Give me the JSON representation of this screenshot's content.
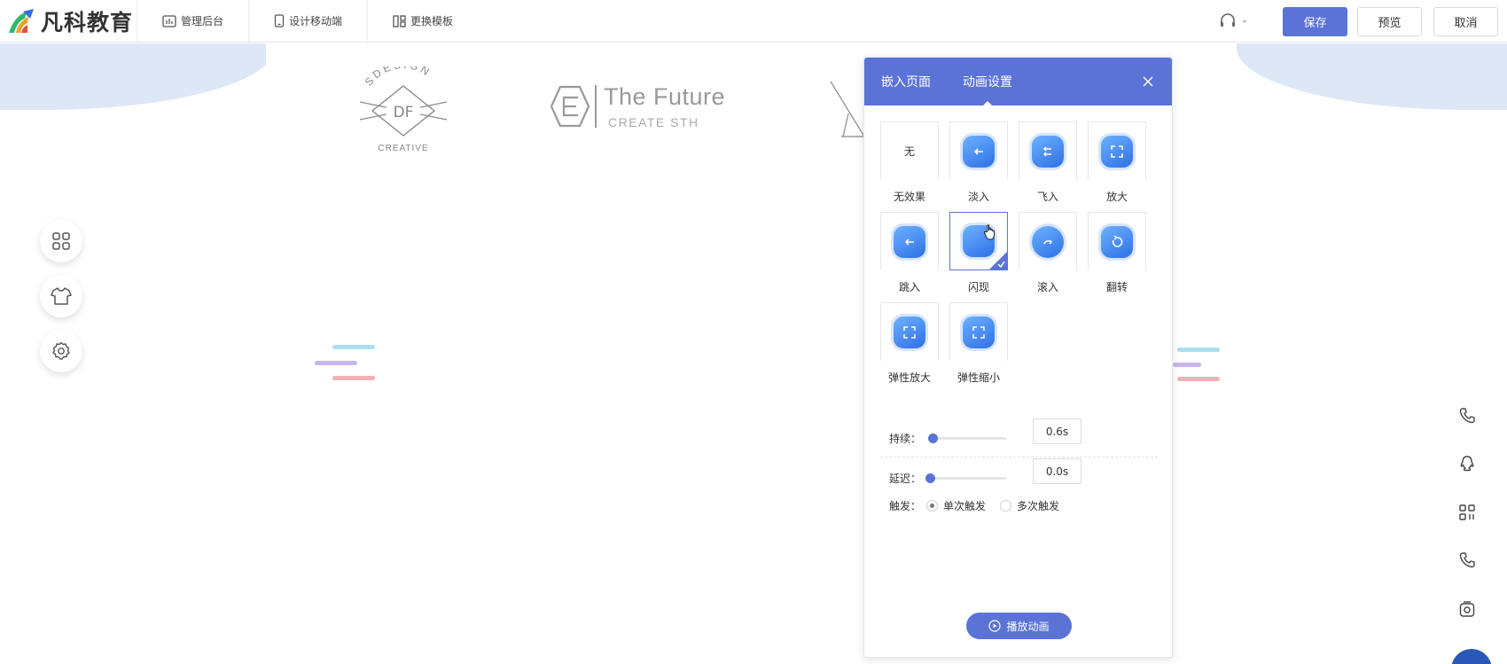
{
  "brand": {
    "name": "凡科教育"
  },
  "nav": [
    {
      "label": "管理后台",
      "icon": "chart-icon"
    },
    {
      "label": "设计移动端",
      "icon": "phone-icon"
    },
    {
      "label": "更换模板",
      "icon": "template-icon"
    }
  ],
  "actions": {
    "save": "保存",
    "preview": "预览",
    "cancel": "取消"
  },
  "colors": {
    "accent": "#5b73d6",
    "band": "#dde7f6"
  },
  "canvas": {
    "logo1": {
      "top": "SDESIGN",
      "mid": "DF",
      "bottom": "CREATIVE"
    },
    "logo2": {
      "title": "The Future",
      "subtitle": "CREATE STH"
    }
  },
  "panel": {
    "tabs": [
      "嵌入页面",
      "动画设置"
    ],
    "active_tab": "动画设置",
    "none_label": "无",
    "effects": [
      "无效果",
      "淡入",
      "飞入",
      "放大",
      "跳入",
      "闪现",
      "滚入",
      "翻转",
      "弹性放大",
      "弹性缩小"
    ],
    "selected_effect": "闪现",
    "duration": {
      "label": "持续：",
      "value": "0.6s"
    },
    "delay": {
      "label": "延迟：",
      "value": "0.0s"
    },
    "trigger": {
      "label": "触发：",
      "options": [
        "单次触发",
        "多次触发"
      ],
      "selected": "单次触发"
    },
    "play_label": "播放动画"
  }
}
